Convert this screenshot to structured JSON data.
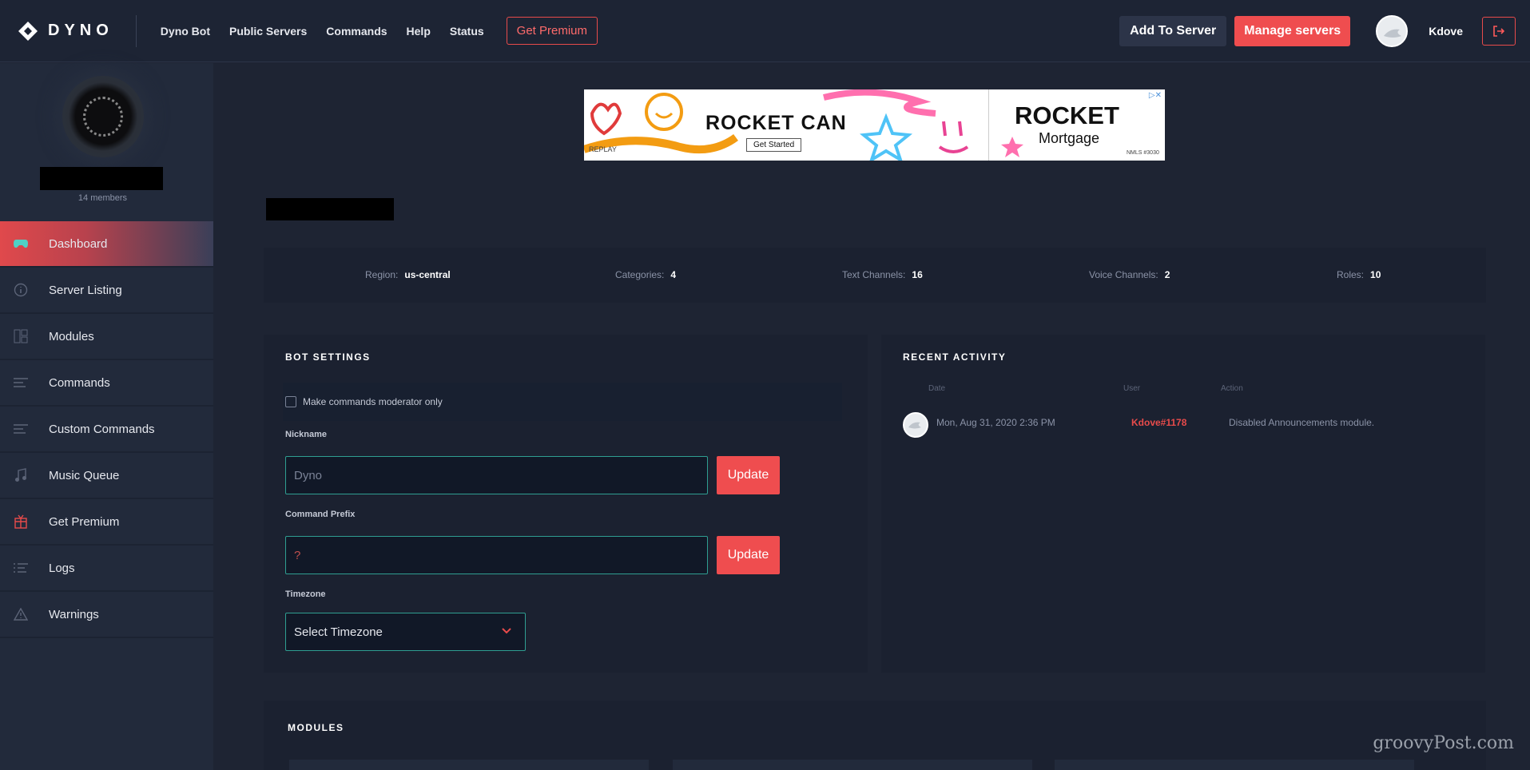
{
  "header": {
    "logo_text": "DYNO",
    "nav": [
      "Dyno Bot",
      "Public Servers",
      "Commands",
      "Help",
      "Status"
    ],
    "premium_label": "Get Premium",
    "add_label": "Add To Server",
    "manage_label": "Manage servers",
    "username": "Kdove",
    "logout_icon": "logout-icon"
  },
  "sidebar": {
    "members": "14 members",
    "items": [
      {
        "label": "Dashboard",
        "icon": "gamepad-icon"
      },
      {
        "label": "Server Listing",
        "icon": "info-icon"
      },
      {
        "label": "Modules",
        "icon": "modules-icon"
      },
      {
        "label": "Commands",
        "icon": "commands-icon"
      },
      {
        "label": "Custom Commands",
        "icon": "custom-commands-icon"
      },
      {
        "label": "Music Queue",
        "icon": "music-icon"
      },
      {
        "label": "Get Premium",
        "icon": "gift-icon"
      },
      {
        "label": "Logs",
        "icon": "logs-icon"
      },
      {
        "label": "Warnings",
        "icon": "warning-icon"
      }
    ]
  },
  "ad": {
    "headline": "ROCKET CAN",
    "cta": "Get Started",
    "replay": "REPLAY",
    "brand": "ROCKET",
    "brand_sub": "Mortgage",
    "nmls": "NMLS #3030"
  },
  "stats": {
    "region_label": "Region:",
    "region": "us-central",
    "categories_label": "Categories:",
    "categories": "4",
    "text_label": "Text Channels:",
    "text_channels": "16",
    "voice_label": "Voice Channels:",
    "voice_channels": "2",
    "roles_label": "Roles:",
    "roles": "10"
  },
  "bot_settings": {
    "title": "BOT SETTINGS",
    "mod_only_label": "Make commands moderator only",
    "nickname_label": "Nickname",
    "nickname_placeholder": "Dyno",
    "prefix_label": "Command Prefix",
    "prefix_value": "?",
    "update_label": "Update",
    "timezone_label": "Timezone",
    "timezone_value": "Select Timezone"
  },
  "recent_activity": {
    "title": "RECENT ACTIVITY",
    "headers": [
      "Date",
      "User",
      "Action"
    ],
    "rows": [
      {
        "date": "Mon, Aug 31, 2020 2:36 PM",
        "user": "Kdove#1178",
        "action": "Disabled Announcements module."
      }
    ]
  },
  "modules": {
    "title": "MODULES"
  },
  "watermark": "groovyPost.com",
  "colors": {
    "accent": "#ef4d4f",
    "teal": "#2f9e91",
    "background": "#1e2433"
  }
}
